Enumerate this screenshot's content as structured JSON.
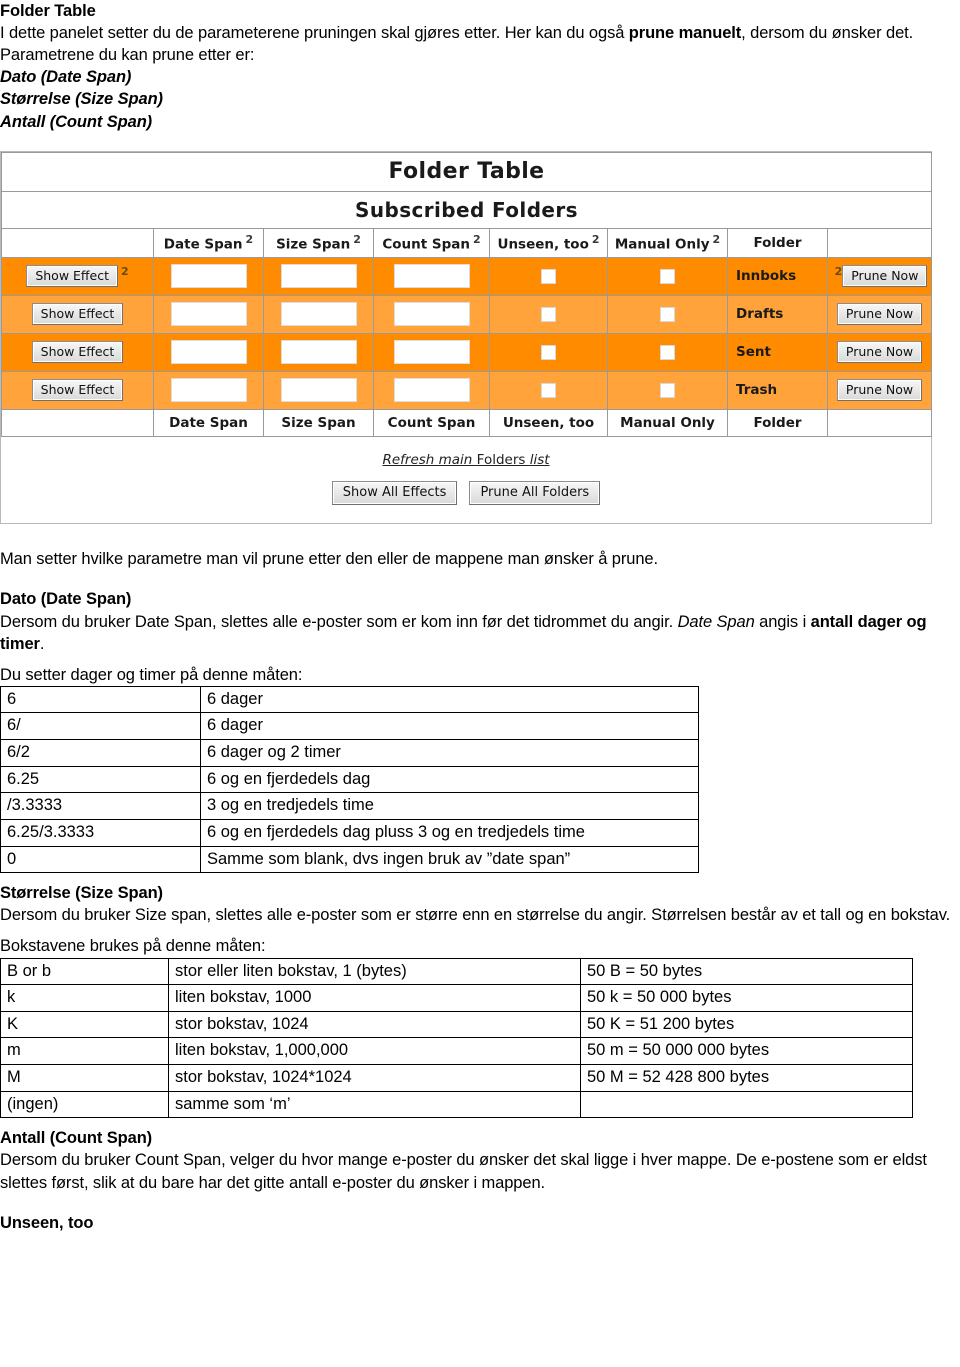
{
  "doc": {
    "heading": "Folder Table",
    "intro_a": "I dette panelet setter du de parameterene pruningen skal gjøres etter. Her kan du også ",
    "intro_b": "prune manuelt",
    "intro_c": ", dersom du ønsker det.",
    "params_lead": "Parametrene du kan prune etter er:",
    "param_items": [
      "Dato (Date Span)",
      "Størrelse (Size Span)",
      "Antall (Count Span)"
    ],
    "after_shot": "Man setter hvilke parametre man vil prune etter den eller de mappene man ønsker å prune.",
    "date_heading": "Dato (Date Span)",
    "date_body_a": "Dersom du bruker Date Span, slettes alle e-poster som er kom inn før det tidrommet du angir. ",
    "date_body_it": "Date Span",
    "date_body_b": " angis i ",
    "date_body_bold": "antall dager og timer",
    "date_body_c": ".",
    "date_table_lead": "Du setter dager og timer på denne måten:",
    "size_heading": "Størrelse (Size Span)",
    "size_body": "Dersom du bruker Size span, slettes alle e-poster som er større enn en størrelse du angir. Størrelsen består av et tall og en bokstav.",
    "size_table_lead": "Bokstavene brukes på denne måten:",
    "count_heading": "Antall (Count Span)",
    "count_body": "Dersom du bruker Count Span, velger du hvor mange e-poster du ønsker det skal ligge i hver mappe. De e-postene som er eldst slettes først, slik at du bare har det gitte antall e-poster du ønsker i mappen.",
    "unseen_heading": "Unseen, too"
  },
  "screenshot": {
    "title": "Folder Table",
    "subtitle": "Subscribed Folders",
    "help_marker": "2",
    "columns": [
      {
        "label": "Date Span",
        "help": "2"
      },
      {
        "label": "Size Span",
        "help": "2"
      },
      {
        "label": "Count Span",
        "help": "2"
      },
      {
        "label": "Unseen, too",
        "help": "2"
      },
      {
        "label": "Manual Only",
        "help": "2"
      },
      {
        "label": "Folder",
        "help": ""
      }
    ],
    "footer_columns": [
      "Date Span",
      "Size Span",
      "Count Span",
      "Unseen, too",
      "Manual Only",
      "Folder"
    ],
    "show_effect_label": "Show Effect",
    "prune_now_label": "Prune Now",
    "rows": [
      {
        "folder": "Innboks",
        "date_span": "",
        "size_span": "",
        "count_span": "",
        "unseen": false,
        "manual": false,
        "show_effect_help": "2",
        "prune_help": "2"
      },
      {
        "folder": "Drafts",
        "date_span": "",
        "size_span": "",
        "count_span": "",
        "unseen": false,
        "manual": false,
        "show_effect_help": "",
        "prune_help": ""
      },
      {
        "folder": "Sent",
        "date_span": "",
        "size_span": "",
        "count_span": "",
        "unseen": false,
        "manual": false,
        "show_effect_help": "",
        "prune_help": ""
      },
      {
        "folder": "Trash",
        "date_span": "",
        "size_span": "",
        "count_span": "",
        "unseen": false,
        "manual": false,
        "show_effect_help": "",
        "prune_help": ""
      }
    ],
    "refresh_link_italic_1": "Refresh main ",
    "refresh_link_plain": "Folders ",
    "refresh_link_italic_2": "list",
    "show_all_effects_label": "Show All Effects",
    "prune_all_folders_label": "Prune All Folders",
    "colors": {
      "row_dark": "#FF8C00",
      "row_light": "#FFA33A",
      "border": "#9A9A9A",
      "button_face": "#E4E4E4"
    }
  },
  "date_table": {
    "rows": [
      {
        "key": "6",
        "desc": "6 dager"
      },
      {
        "key": "6/",
        "desc": "6 dager"
      },
      {
        "key": "6/2",
        "desc": "6 dager og 2 timer"
      },
      {
        "key": "6.25",
        "desc": "6 og en fjerdedels dag"
      },
      {
        "key": "/3.3333",
        "desc": "3 og en tredjedels time"
      },
      {
        "key": "6.25/3.3333",
        "desc": "6 og en fjerdedels dag pluss 3 og en tredjedels time"
      },
      {
        "key": "0",
        "desc": "Samme som blank, dvs ingen bruk av ”date span”"
      }
    ]
  },
  "size_table": {
    "rows": [
      {
        "letter": "B or b",
        "meaning": "stor eller liten bokstav, 1 (bytes)",
        "example": "50 B = 50 bytes"
      },
      {
        "letter": "k",
        "meaning": "liten bokstav, 1000",
        "example": "50 k = 50 000 bytes"
      },
      {
        "letter": "K",
        "meaning": "stor bokstav, 1024",
        "example": "50 K = 51 200 bytes"
      },
      {
        "letter": "m",
        "meaning": "liten bokstav, 1,000,000",
        "example": "50 m = 50 000 000 bytes"
      },
      {
        "letter": "M",
        "meaning": "stor bokstav, 1024*1024",
        "example": "50 M = 52 428 800 bytes"
      },
      {
        "letter": "(ingen)",
        "meaning": "samme som ‘m’",
        "example": ""
      }
    ]
  }
}
